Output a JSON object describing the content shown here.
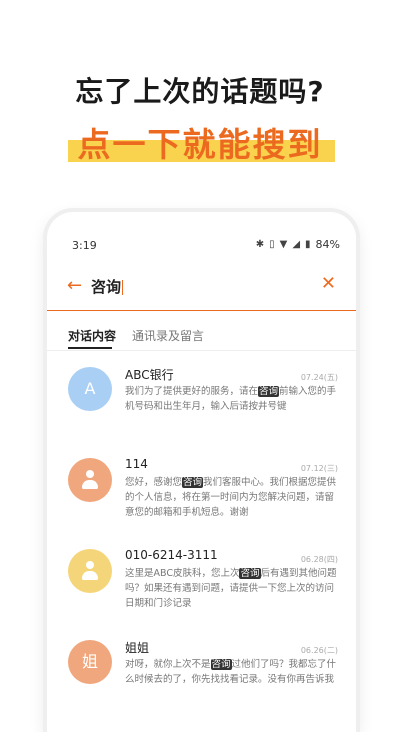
{
  "promo": {
    "headline": "忘了上次的话题吗?",
    "highlight": "点一下就能搜到"
  },
  "status_bar": {
    "time": "3:19",
    "battery": "84%",
    "icons": [
      "bluetooth-icon",
      "vibrate-icon",
      "wifi-icon",
      "signal-icon",
      "battery-icon"
    ]
  },
  "search": {
    "query": "咨询",
    "back_icon": "arrow-left-icon",
    "clear_icon": "close-icon"
  },
  "tabs": [
    {
      "label": "对话内容",
      "active": true
    },
    {
      "label": "通讯录及留言",
      "active": false
    }
  ],
  "results": [
    {
      "avatar": {
        "type": "letter",
        "text": "A",
        "color": "#a9cff4"
      },
      "name": "ABC银行",
      "date": "07.24(五)",
      "message": {
        "before": "我们为了提供更好的服务，请在",
        "match": "咨询",
        "after": "前输入您的手机号码和出生年月，输入后请按井号键"
      }
    },
    {
      "avatar": {
        "type": "person",
        "color": "#f0a77d"
      },
      "name": "114",
      "date": "07.12(三)",
      "message": {
        "before": "您好，感谢您",
        "match": "咨询",
        "after": "我们客服中心。我们根据您提供的个人信息，将在第一时间内为您解决问题，请留意您的邮箱和手机短息。谢谢"
      }
    },
    {
      "avatar": {
        "type": "person",
        "color": "#f5d57a"
      },
      "name": "010-6214-3111",
      "date": "06.28(四)",
      "message": {
        "before": "这里是ABC皮肤科，您上次",
        "match": "咨询",
        "after": "后有遇到其他问题吗？如果还有遇到问题，请提供一下您上次的访问日期和门诊记录"
      }
    },
    {
      "avatar": {
        "type": "letter",
        "text": "姐",
        "color": "#f0a77d"
      },
      "name": "姐姐",
      "date": "06.26(二)",
      "message": {
        "before": "对呀，就你上次不是",
        "match": "咨询",
        "after": "过他们了吗？我都忘了什么时候去的了，你先找找看记录。没有你再告诉我"
      }
    }
  ],
  "colors": {
    "accent": "#ec6a1f",
    "highlight_bg": "#f9d34d"
  }
}
